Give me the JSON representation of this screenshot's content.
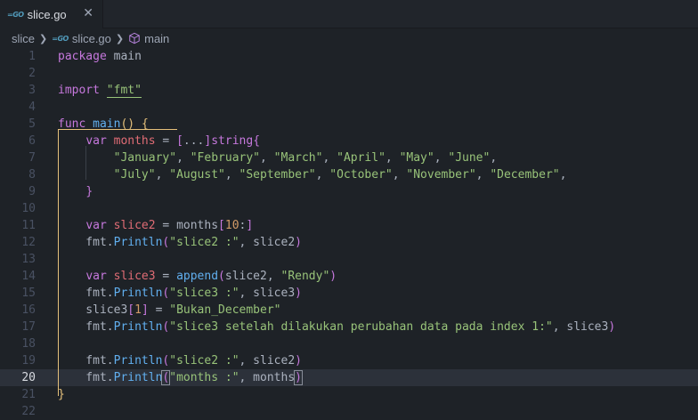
{
  "tab": {
    "label": "slice.go",
    "icon": "go-file-icon",
    "close_glyph": "✕"
  },
  "breadcrumb": {
    "folder": "slice",
    "file": "slice.go",
    "symbol": "main"
  },
  "editor": {
    "current_line": 20,
    "line_numbers": [
      "1",
      "2",
      "3",
      "4",
      "5",
      "6",
      "7",
      "8",
      "9",
      "10",
      "11",
      "12",
      "13",
      "14",
      "15",
      "16",
      "17",
      "18",
      "19",
      "20",
      "21",
      "22"
    ],
    "lines": [
      [
        {
          "t": "package",
          "c": "kw"
        },
        {
          "t": " main",
          "c": "pl"
        }
      ],
      [],
      [
        {
          "t": "import",
          "c": "kw"
        },
        {
          "t": " ",
          "c": "pl"
        },
        {
          "t": "\"fmt\"",
          "c": "str"
        }
      ],
      [],
      [
        {
          "t": "func",
          "c": "kw"
        },
        {
          "t": " ",
          "c": "pl"
        },
        {
          "t": "main",
          "c": "fn"
        },
        {
          "t": "()",
          "c": "br"
        },
        {
          "t": " ",
          "c": "pl"
        },
        {
          "t": "{",
          "c": "br"
        }
      ],
      [
        {
          "t": "    ",
          "c": "pl"
        },
        {
          "t": "var",
          "c": "kw"
        },
        {
          "t": " ",
          "c": "pl"
        },
        {
          "t": "months",
          "c": "var"
        },
        {
          "t": " = ",
          "c": "pl"
        },
        {
          "t": "[",
          "c": "br2"
        },
        {
          "t": "...",
          "c": "pl"
        },
        {
          "t": "]",
          "c": "br2"
        },
        {
          "t": "string",
          "c": "kw"
        },
        {
          "t": "{",
          "c": "br2"
        }
      ],
      [
        {
          "t": "        ",
          "c": "pl"
        },
        {
          "t": "\"January\"",
          "c": "str"
        },
        {
          "t": ", ",
          "c": "pl"
        },
        {
          "t": "\"February\"",
          "c": "str"
        },
        {
          "t": ", ",
          "c": "pl"
        },
        {
          "t": "\"March\"",
          "c": "str"
        },
        {
          "t": ", ",
          "c": "pl"
        },
        {
          "t": "\"April\"",
          "c": "str"
        },
        {
          "t": ", ",
          "c": "pl"
        },
        {
          "t": "\"May\"",
          "c": "str"
        },
        {
          "t": ", ",
          "c": "pl"
        },
        {
          "t": "\"June\"",
          "c": "str"
        },
        {
          "t": ",",
          "c": "pl"
        }
      ],
      [
        {
          "t": "        ",
          "c": "pl"
        },
        {
          "t": "\"July\"",
          "c": "str"
        },
        {
          "t": ", ",
          "c": "pl"
        },
        {
          "t": "\"August\"",
          "c": "str"
        },
        {
          "t": ", ",
          "c": "pl"
        },
        {
          "t": "\"September\"",
          "c": "str"
        },
        {
          "t": ", ",
          "c": "pl"
        },
        {
          "t": "\"October\"",
          "c": "str"
        },
        {
          "t": ", ",
          "c": "pl"
        },
        {
          "t": "\"November\"",
          "c": "str"
        },
        {
          "t": ", ",
          "c": "pl"
        },
        {
          "t": "\"December\"",
          "c": "str"
        },
        {
          "t": ",",
          "c": "pl"
        }
      ],
      [
        {
          "t": "    ",
          "c": "pl"
        },
        {
          "t": "}",
          "c": "br2"
        }
      ],
      [],
      [
        {
          "t": "    ",
          "c": "pl"
        },
        {
          "t": "var",
          "c": "kw"
        },
        {
          "t": " ",
          "c": "pl"
        },
        {
          "t": "slice2",
          "c": "var"
        },
        {
          "t": " = months",
          "c": "pl"
        },
        {
          "t": "[",
          "c": "br2"
        },
        {
          "t": "10",
          "c": "num"
        },
        {
          "t": ":",
          "c": "pl"
        },
        {
          "t": "]",
          "c": "br2"
        }
      ],
      [
        {
          "t": "    fmt.",
          "c": "pl"
        },
        {
          "t": "Println",
          "c": "fn"
        },
        {
          "t": "(",
          "c": "br2"
        },
        {
          "t": "\"slice2 :\"",
          "c": "str"
        },
        {
          "t": ", slice2",
          "c": "pl"
        },
        {
          "t": ")",
          "c": "br2"
        }
      ],
      [],
      [
        {
          "t": "    ",
          "c": "pl"
        },
        {
          "t": "var",
          "c": "kw"
        },
        {
          "t": " ",
          "c": "pl"
        },
        {
          "t": "slice3",
          "c": "var"
        },
        {
          "t": " = ",
          "c": "pl"
        },
        {
          "t": "append",
          "c": "fn"
        },
        {
          "t": "(",
          "c": "br2"
        },
        {
          "t": "slice2, ",
          "c": "pl"
        },
        {
          "t": "\"Rendy\"",
          "c": "str"
        },
        {
          "t": ")",
          "c": "br2"
        }
      ],
      [
        {
          "t": "    fmt.",
          "c": "pl"
        },
        {
          "t": "Println",
          "c": "fn"
        },
        {
          "t": "(",
          "c": "br2"
        },
        {
          "t": "\"slice3 :\"",
          "c": "str"
        },
        {
          "t": ", slice3",
          "c": "pl"
        },
        {
          "t": ")",
          "c": "br2"
        }
      ],
      [
        {
          "t": "    slice3",
          "c": "pl"
        },
        {
          "t": "[",
          "c": "br2"
        },
        {
          "t": "1",
          "c": "num"
        },
        {
          "t": "]",
          "c": "br2"
        },
        {
          "t": " = ",
          "c": "pl"
        },
        {
          "t": "\"Bukan_December\"",
          "c": "str"
        }
      ],
      [
        {
          "t": "    fmt.",
          "c": "pl"
        },
        {
          "t": "Println",
          "c": "fn"
        },
        {
          "t": "(",
          "c": "br2"
        },
        {
          "t": "\"slice3 setelah dilakukan perubahan data pada index 1:\"",
          "c": "str"
        },
        {
          "t": ", slice3",
          "c": "pl"
        },
        {
          "t": ")",
          "c": "br2"
        }
      ],
      [],
      [
        {
          "t": "    fmt.",
          "c": "pl"
        },
        {
          "t": "Println",
          "c": "fn"
        },
        {
          "t": "(",
          "c": "br2"
        },
        {
          "t": "\"slice2 :\"",
          "c": "str"
        },
        {
          "t": ", slice2",
          "c": "pl"
        },
        {
          "t": ")",
          "c": "br2"
        }
      ],
      [
        {
          "t": "    fmt.",
          "c": "pl"
        },
        {
          "t": "Println",
          "c": "fn"
        },
        {
          "t": "(",
          "c": "br2"
        },
        {
          "t": "\"months :\"",
          "c": "str"
        },
        {
          "t": ", months",
          "c": "pl"
        },
        {
          "t": ")",
          "c": "br2"
        }
      ],
      [
        {
          "t": "}",
          "c": "br"
        }
      ],
      []
    ]
  },
  "colors": {
    "background": "#1e2227",
    "keyword": "#c678dd",
    "function": "#61afef",
    "string": "#98c379",
    "variable": "#e06c75",
    "bracket_highlight": "#e5c07b"
  }
}
